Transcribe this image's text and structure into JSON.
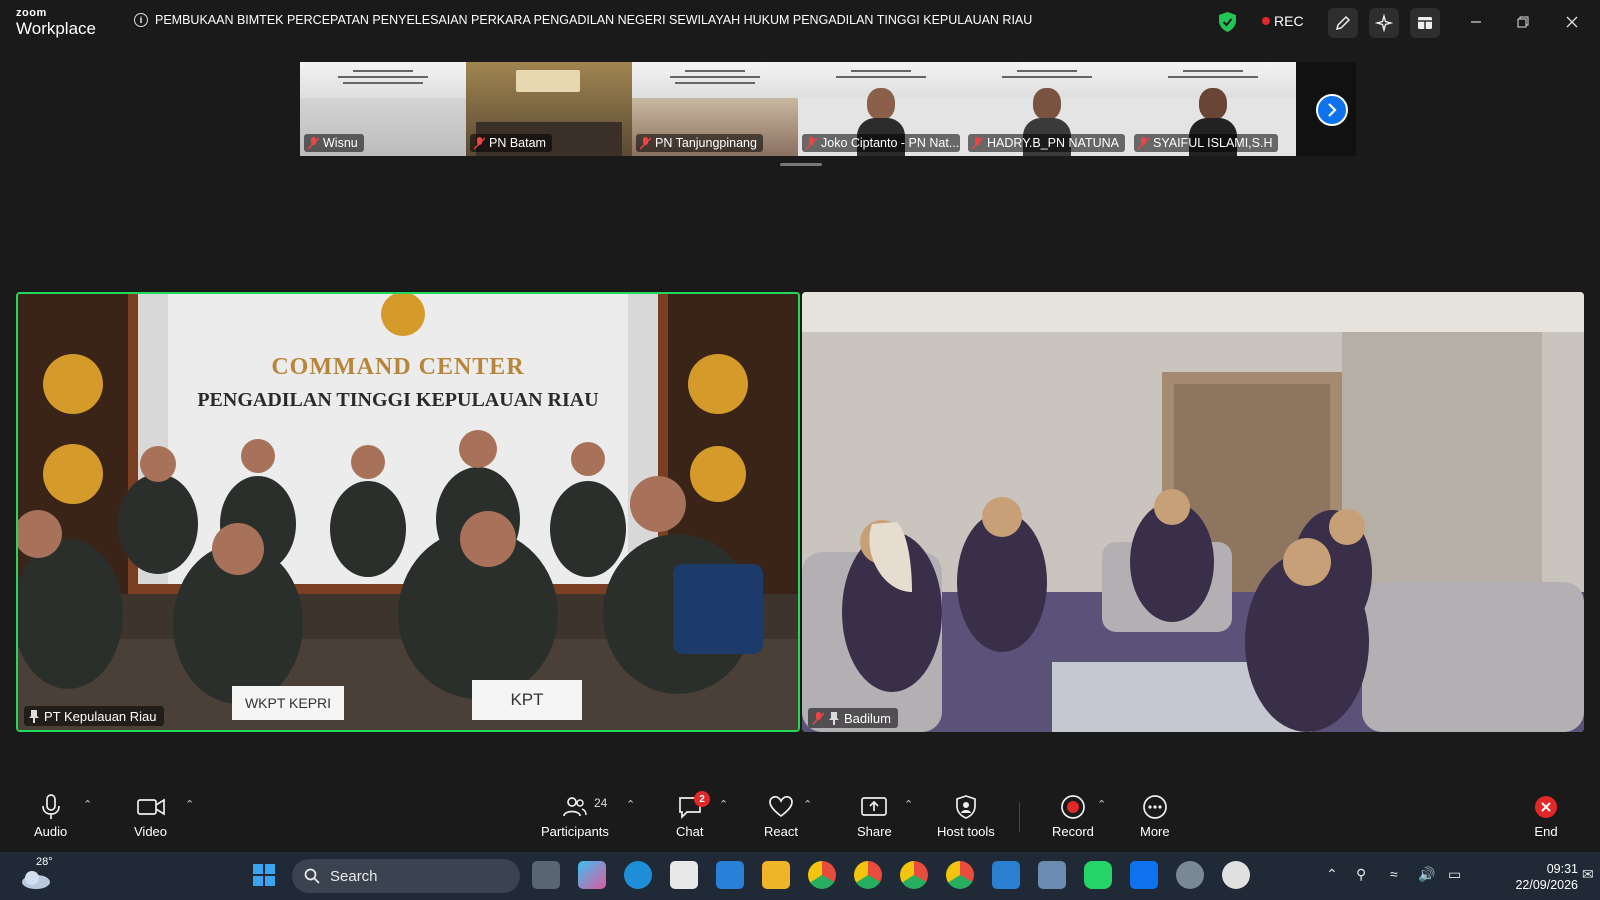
{
  "app": {
    "logo_top": "zoom",
    "logo_bottom": "Workplace"
  },
  "meeting": {
    "title": "PEMBUKAAN BIMTEK PERCEPATAN PENYELESAIAN PERKARA PENGADILAN NEGERI SEWILAYAH HUKUM PENGADILAN TINGGI KEPULAUAN RIAU",
    "rec_label": "REC"
  },
  "thumbnails": [
    {
      "name": "Wisnu"
    },
    {
      "name": "PN Batam"
    },
    {
      "name": "PN Tanjungpinang"
    },
    {
      "name": "Joko Ciptanto - PN Nat..."
    },
    {
      "name": "HADRY.B_PN NATUNA"
    },
    {
      "name": "SYAIFUL ISLAMI,S.H"
    }
  ],
  "thumb_banner_text": "BIMBINGAN TEKNIS PERCEPATAN PENYELESAIAN PERKARA",
  "main_tiles": {
    "left": {
      "name": "PT Kepulauan Riau",
      "wall_line1": "COMMAND CENTER",
      "wall_line2": "PENGADILAN TINGGI KEPULAUAN RIAU",
      "placard1": "WKPT KEPRI",
      "placard2": "KPT"
    },
    "right": {
      "name": "Badilum"
    }
  },
  "toolbar": {
    "audio": "Audio",
    "video": "Video",
    "participants": "Participants",
    "participants_count": "24",
    "chat": "Chat",
    "chat_badge": "2",
    "react": "React",
    "share": "Share",
    "host_tools": "Host tools",
    "record": "Record",
    "more": "More",
    "end": "End"
  },
  "taskbar": {
    "weather_temp": "28°",
    "search_placeholder": "Search",
    "time": "09:31",
    "date": "22/09/2026"
  },
  "colors": {
    "accent": "#0e72ed",
    "active_speaker": "#23d959",
    "rec": "#e02828",
    "end": "#e02828"
  }
}
